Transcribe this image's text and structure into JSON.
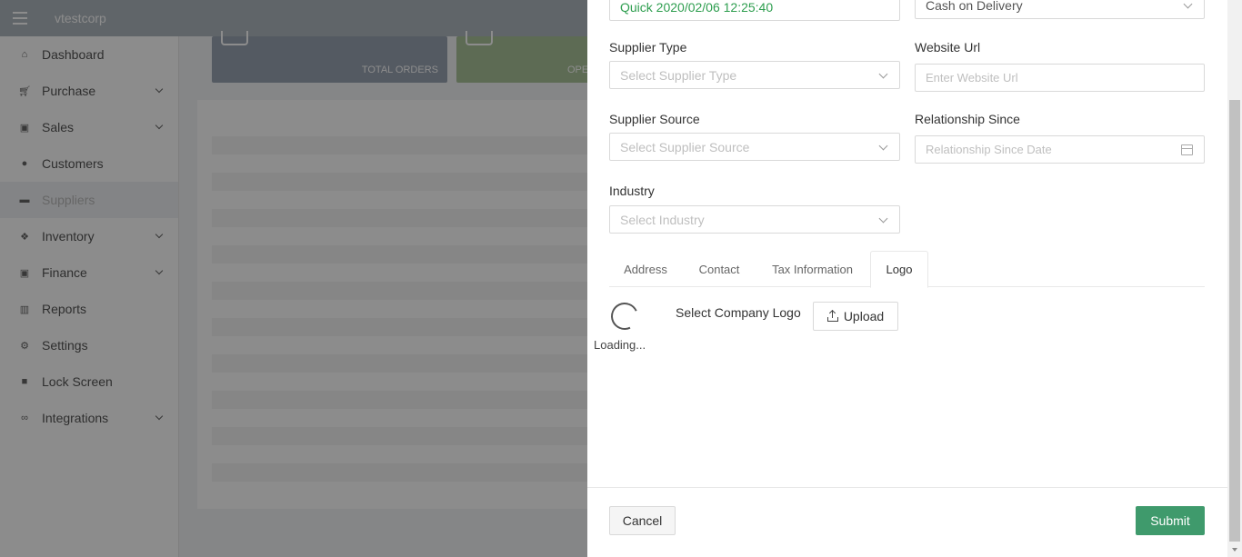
{
  "app": {
    "brand": "vtestcorp"
  },
  "sidebar": {
    "items": [
      {
        "label": "Dashboard",
        "icon": "home-icon",
        "chevron": false
      },
      {
        "label": "Purchase",
        "icon": "cart-icon",
        "chevron": true
      },
      {
        "label": "Sales",
        "icon": "money-icon",
        "chevron": true
      },
      {
        "label": "Customers",
        "icon": "user-icon",
        "chevron": false
      },
      {
        "label": "Suppliers",
        "icon": "truck-icon",
        "chevron": false,
        "active": true
      },
      {
        "label": "Inventory",
        "icon": "cubes-icon",
        "chevron": true
      },
      {
        "label": "Finance",
        "icon": "money-icon",
        "chevron": true
      },
      {
        "label": "Reports",
        "icon": "bar-chart-icon",
        "chevron": false
      },
      {
        "label": "Settings",
        "icon": "gears-icon",
        "chevron": false
      },
      {
        "label": "Lock Screen",
        "icon": "lock-icon",
        "chevron": false
      },
      {
        "label": "Integrations",
        "icon": "link-icon",
        "chevron": true
      }
    ]
  },
  "dashboard": {
    "cards": [
      {
        "label": "TOTAL ORDERS",
        "color": "#9aa4b3"
      },
      {
        "label": "OPE",
        "color": "#a9c49a"
      }
    ]
  },
  "form": {
    "supplier_name_value": "Quick 2020/02/06 12:25:40",
    "payment_method_value": "Cash on Delivery",
    "supplier_type": {
      "label": "Supplier Type",
      "placeholder": "Select Supplier Type"
    },
    "website_url": {
      "label": "Website Url",
      "placeholder": "Enter Website Url"
    },
    "supplier_source": {
      "label": "Supplier Source",
      "placeholder": "Select Supplier Source"
    },
    "relationship_since": {
      "label": "Relationship Since",
      "placeholder": "Relationship Since Date"
    },
    "industry": {
      "label": "Industry",
      "placeholder": "Select Industry"
    }
  },
  "tabs": [
    {
      "label": "Address"
    },
    {
      "label": "Contact"
    },
    {
      "label": "Tax Information"
    },
    {
      "label": "Logo",
      "active": true
    }
  ],
  "logo_tab": {
    "loading_text": "Loading...",
    "select_label": "Select Company Logo",
    "upload_label": "Upload"
  },
  "footer": {
    "cancel_label": "Cancel",
    "submit_label": "Submit"
  },
  "colors": {
    "accent_green": "#3f9a6c",
    "value_green": "#2e9e4f"
  }
}
